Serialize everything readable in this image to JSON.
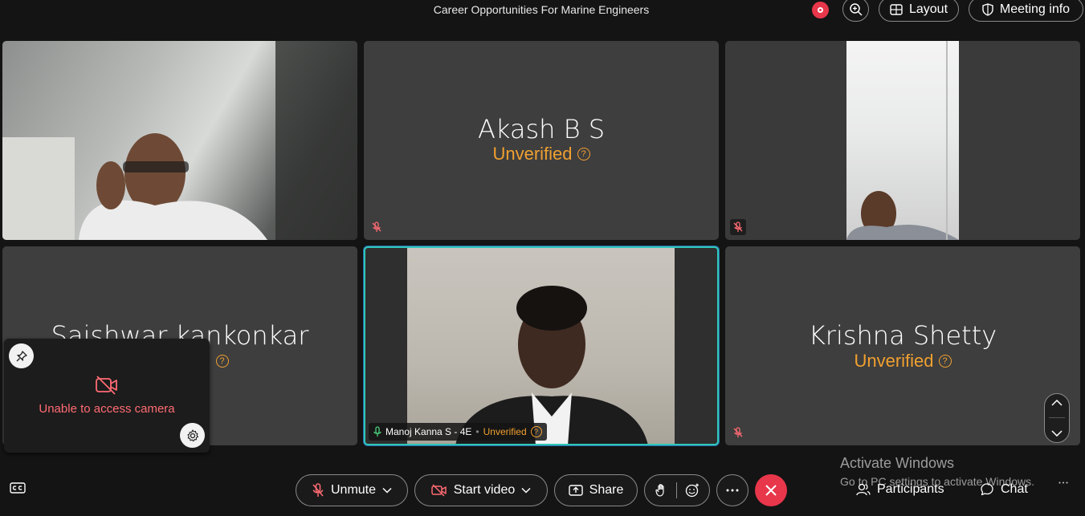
{
  "header": {
    "meeting_title": "Career Opportunities For Marine Engineers",
    "layout_label": "Layout",
    "meeting_info_label": "Meeting info"
  },
  "tiles": [
    {
      "id": "video-1",
      "has_video": true
    },
    {
      "id": "akash",
      "name": "Akash B S",
      "status": "Unverified",
      "muted": true
    },
    {
      "id": "video-3",
      "has_video": true,
      "muted": true
    },
    {
      "id": "saishwar",
      "name": "Saishwar kankonkar",
      "status": "Unverified"
    },
    {
      "id": "manoj",
      "name": "Manoj Kanna S - 4E",
      "status": "Unverified",
      "has_video": true,
      "active_speaker": true
    },
    {
      "id": "krishna",
      "name": "Krishna Shetty",
      "status": "Unverified",
      "muted": true
    }
  ],
  "tile_name": {
    "akash": "Akash B S",
    "saishwar": "Saishwar kankonkar",
    "manoj": "Manoj Kanna S - 4E",
    "krishna": "Krishna Shetty"
  },
  "status_label": "Unverified",
  "self_view": {
    "error_text": "Unable to access camera"
  },
  "controls": {
    "unmute_label": "Unmute",
    "start_video_label": "Start video",
    "share_label": "Share",
    "participants_label": "Participants",
    "chat_label": "Chat"
  },
  "watermark": {
    "line1": "Activate Windows",
    "line2": "Go to PC settings to activate Windows."
  },
  "colors": {
    "accent_red": "#e8364b",
    "unverified": "#f0a030",
    "active_border": "#2fc7b8",
    "camera_error": "#ff6b73"
  }
}
